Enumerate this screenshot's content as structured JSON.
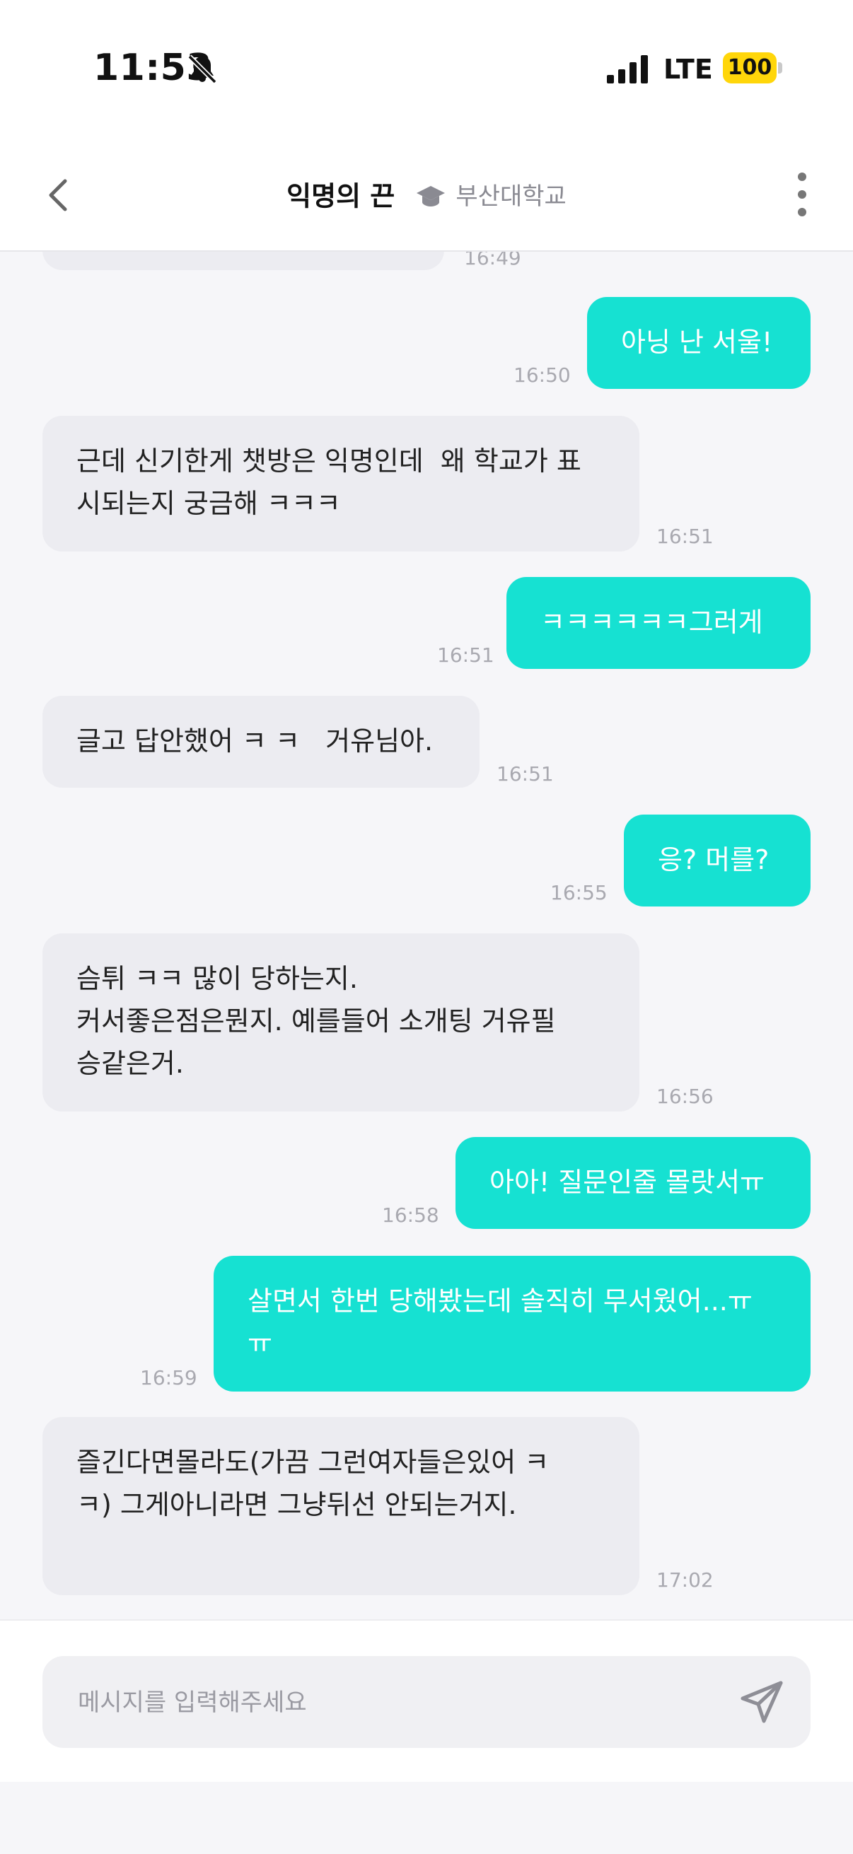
{
  "status_bar": {
    "time": "11:53",
    "network": "LTE",
    "battery": "100"
  },
  "header": {
    "title": "익명의 끈",
    "school": "부산대학교"
  },
  "messages": [
    {
      "side": "in",
      "text": "",
      "time": "16:49"
    },
    {
      "side": "out",
      "text": "아닝 난 서울!",
      "time": "16:50"
    },
    {
      "side": "in",
      "text": "근데 신기한게 챗방은 익명인데  왜 학교가 표\n시되는지 궁금해 ㅋㅋㅋ",
      "time": "16:51"
    },
    {
      "side": "out",
      "text": "ㅋㅋㅋㅋㅋㅋ그러게",
      "time": "16:51"
    },
    {
      "side": "in",
      "text": "글고 답안했어 ㅋ ㅋ   거유님아.",
      "time": "16:51"
    },
    {
      "side": "out",
      "text": "응? 머를?",
      "time": "16:55"
    },
    {
      "side": "in",
      "text": "슴튀 ㅋㅋ 많이 당하는지.\n커서좋은점은뭔지. 예를들어 소개팅 거유필\n승같은거.",
      "time": "16:56"
    },
    {
      "side": "out",
      "text": "아아! 질문인줄 몰랏서ㅠ",
      "time": "16:58"
    },
    {
      "side": "out",
      "text": "살면서 한번 당해봤는데 솔직히 무서웠어...ㅠ\nㅠ",
      "time": "16:59"
    },
    {
      "side": "in",
      "text": "즐긴다면몰라도(가끔 그런여자들은있어 ㅋ\nㅋ) 그게아니라면 그냥뒤선 안되는거지.",
      "time": "17:02"
    }
  ],
  "composer": {
    "placeholder": "메시지를 입력해주세요"
  }
}
